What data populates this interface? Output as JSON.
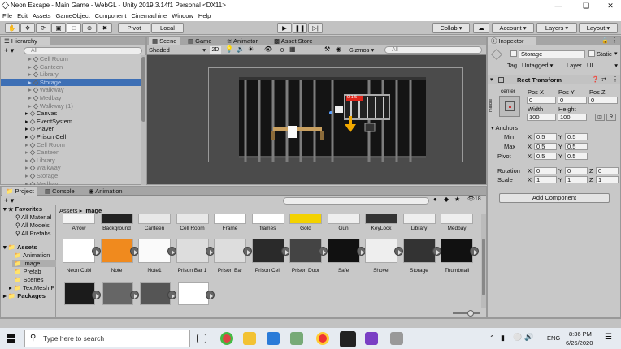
{
  "window": {
    "title": "Neon Escape - Main Game - WebGL - Unity 2019.3.14f1 Personal <DX11>"
  },
  "menu": [
    "File",
    "Edit",
    "Assets",
    "GameObject",
    "Component",
    "Cinemachine",
    "Window",
    "Help"
  ],
  "toolbar": {
    "pivot": "Pivot",
    "local": "Local",
    "collab": "Collab",
    "account": "Account",
    "layers": "Layers",
    "layout": "Layout"
  },
  "hierarchy": {
    "tab": "Hierarchy",
    "search_placeholder": "All",
    "items": [
      {
        "label": "Cell Room",
        "dim": true,
        "indent": 2
      },
      {
        "label": "Canteen",
        "dim": true,
        "indent": 2
      },
      {
        "label": "Library",
        "dim": true,
        "indent": 2
      },
      {
        "label": "Storage",
        "dim": true,
        "indent": 2,
        "selected": true
      },
      {
        "label": "Walkway",
        "dim": true,
        "indent": 2
      },
      {
        "label": "Medbay",
        "dim": true,
        "indent": 2
      },
      {
        "label": "Walkway (1)",
        "dim": true,
        "indent": 2
      },
      {
        "label": "Canvas",
        "dim": false,
        "indent": 1
      },
      {
        "label": "EventSystem",
        "dim": false,
        "indent": 1
      },
      {
        "label": "Player",
        "dim": false,
        "indent": 1
      },
      {
        "label": "Prison Cell",
        "dim": false,
        "indent": 1
      },
      {
        "label": "Cell Room",
        "dim": true,
        "indent": 1
      },
      {
        "label": "Canteen",
        "dim": true,
        "indent": 1
      },
      {
        "label": "Library",
        "dim": true,
        "indent": 1
      },
      {
        "label": "Walkway",
        "dim": true,
        "indent": 1
      },
      {
        "label": "Storage",
        "dim": true,
        "indent": 1
      },
      {
        "label": "Medbay",
        "dim": true,
        "indent": 1
      }
    ]
  },
  "scene": {
    "tabs": [
      "Scene",
      "Game",
      "Animator",
      "Asset Store"
    ],
    "shading": "Shaded",
    "mode2d": "2D",
    "hidden_count": "0",
    "gizmos": "Gizmos",
    "search_placeholder": "All",
    "sign_text": "0.1 5"
  },
  "inspector": {
    "tab": "Inspector",
    "object_name": "Storage",
    "static_label": "Static",
    "tag_label": "Tag",
    "tag_value": "Untagged",
    "layer_label": "Layer",
    "layer_value": "UI",
    "rect_transform": "Rect Transform",
    "anchor_preset": "center",
    "side_label": "middle",
    "pos_x_label": "Pos X",
    "pos_y_label": "Pos Y",
    "pos_z_label": "Pos Z",
    "pos_x": "0",
    "pos_y": "0",
    "pos_z": "0",
    "width_label": "Width",
    "height_label": "Height",
    "width": "100",
    "height": "100",
    "r_btn": "R",
    "anchors_label": "Anchors",
    "min_label": "Min",
    "max_label": "Max",
    "pivot_label": "Pivot",
    "rotation_label": "Rotation",
    "scale_label": "Scale",
    "x": "X",
    "y": "Y",
    "z": "Z",
    "anchor_min_x": "0.5",
    "anchor_min_y": "0.5",
    "anchor_max_x": "0.5",
    "anchor_max_y": "0.5",
    "pivot_x": "0.5",
    "pivot_y": "0.5",
    "rot_x": "0",
    "rot_y": "0",
    "rot_z": "0",
    "scale_x": "1",
    "scale_y": "1",
    "scale_z": "1",
    "add_component": "Add Component"
  },
  "project": {
    "tabs": [
      "Project",
      "Console",
      "Animation"
    ],
    "favorites_label": "Favorites",
    "favorites": [
      "All Material",
      "All Models",
      "All Prefabs"
    ],
    "assets_label": "Assets",
    "folders": [
      "Animation",
      "Image",
      "Prefab",
      "Scenes",
      "TextMesh P"
    ],
    "packages_label": "Packages",
    "breadcrumb_root": "Assets",
    "breadcrumb_sep": "▸",
    "breadcrumb_current": "Image",
    "hidden_count": "18",
    "row1": [
      "Arrow",
      "Background",
      "Canteen",
      "Cell Room",
      "Frame",
      "frames",
      "Gold",
      "Gun",
      "KeyLock",
      "Library",
      "Medbay"
    ],
    "row2": [
      "Neon Cubi",
      "Note",
      "Note1",
      "Prison Bar 1",
      "Prison Bar",
      "Prison Cell",
      "Prison Door",
      "Safe",
      "Shovel",
      "Storage",
      "Thumbnail"
    ]
  },
  "taskbar": {
    "search_placeholder": "Type here to search",
    "lang": "ENG",
    "time": "8:36 PM",
    "date": "6/26/2020"
  }
}
